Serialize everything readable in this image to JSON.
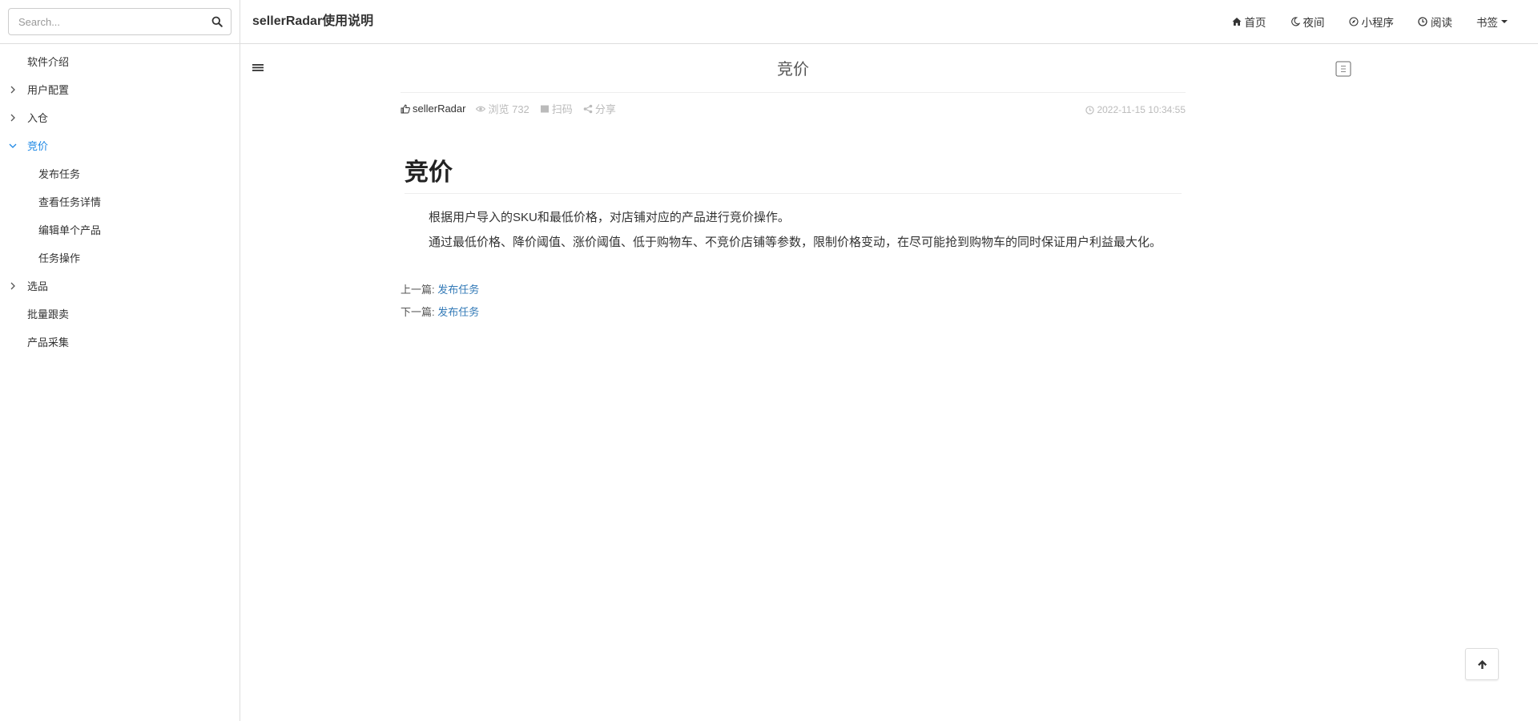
{
  "search": {
    "placeholder": "Search..."
  },
  "sidebar": {
    "items": [
      {
        "label": "软件介绍"
      },
      {
        "label": "用户配置"
      },
      {
        "label": "入仓"
      },
      {
        "label": "竞价"
      },
      {
        "label": "发布任务"
      },
      {
        "label": "查看任务详情"
      },
      {
        "label": "编辑单个产品"
      },
      {
        "label": "任务操作"
      },
      {
        "label": "选品"
      },
      {
        "label": "批量跟卖"
      },
      {
        "label": "产品采集"
      }
    ]
  },
  "header": {
    "brand": "sellerRadar使用说明",
    "nav": {
      "home": "首页",
      "night": "夜间",
      "miniapp": "小程序",
      "reading": "阅读",
      "bookmark": "书签"
    }
  },
  "page": {
    "title": "竞价"
  },
  "meta": {
    "author": "sellerRadar",
    "views": "浏览 732",
    "scan": "扫码",
    "share": "分享",
    "datetime": "2022-11-15 10:34:55"
  },
  "article": {
    "heading": "竞价",
    "paragraphs": [
      "根据用户导入的SKU和最低价格，对店铺对应的产品进行竞价操作。",
      "通过最低价格、降价阈值、涨价阈值、低于购物车、不竞价店铺等参数，限制价格变动，在尽可能抢到购物车的同时保证用户利益最大化。"
    ]
  },
  "pager": {
    "prev_label": "上一篇:",
    "prev_link": "发布任务",
    "next_label": "下一篇:",
    "next_link": "发布任务"
  },
  "colors": {
    "active": "#1e88e5",
    "link": "#337ab7",
    "muted": "#bbbbbb",
    "border": "#dddddd"
  }
}
